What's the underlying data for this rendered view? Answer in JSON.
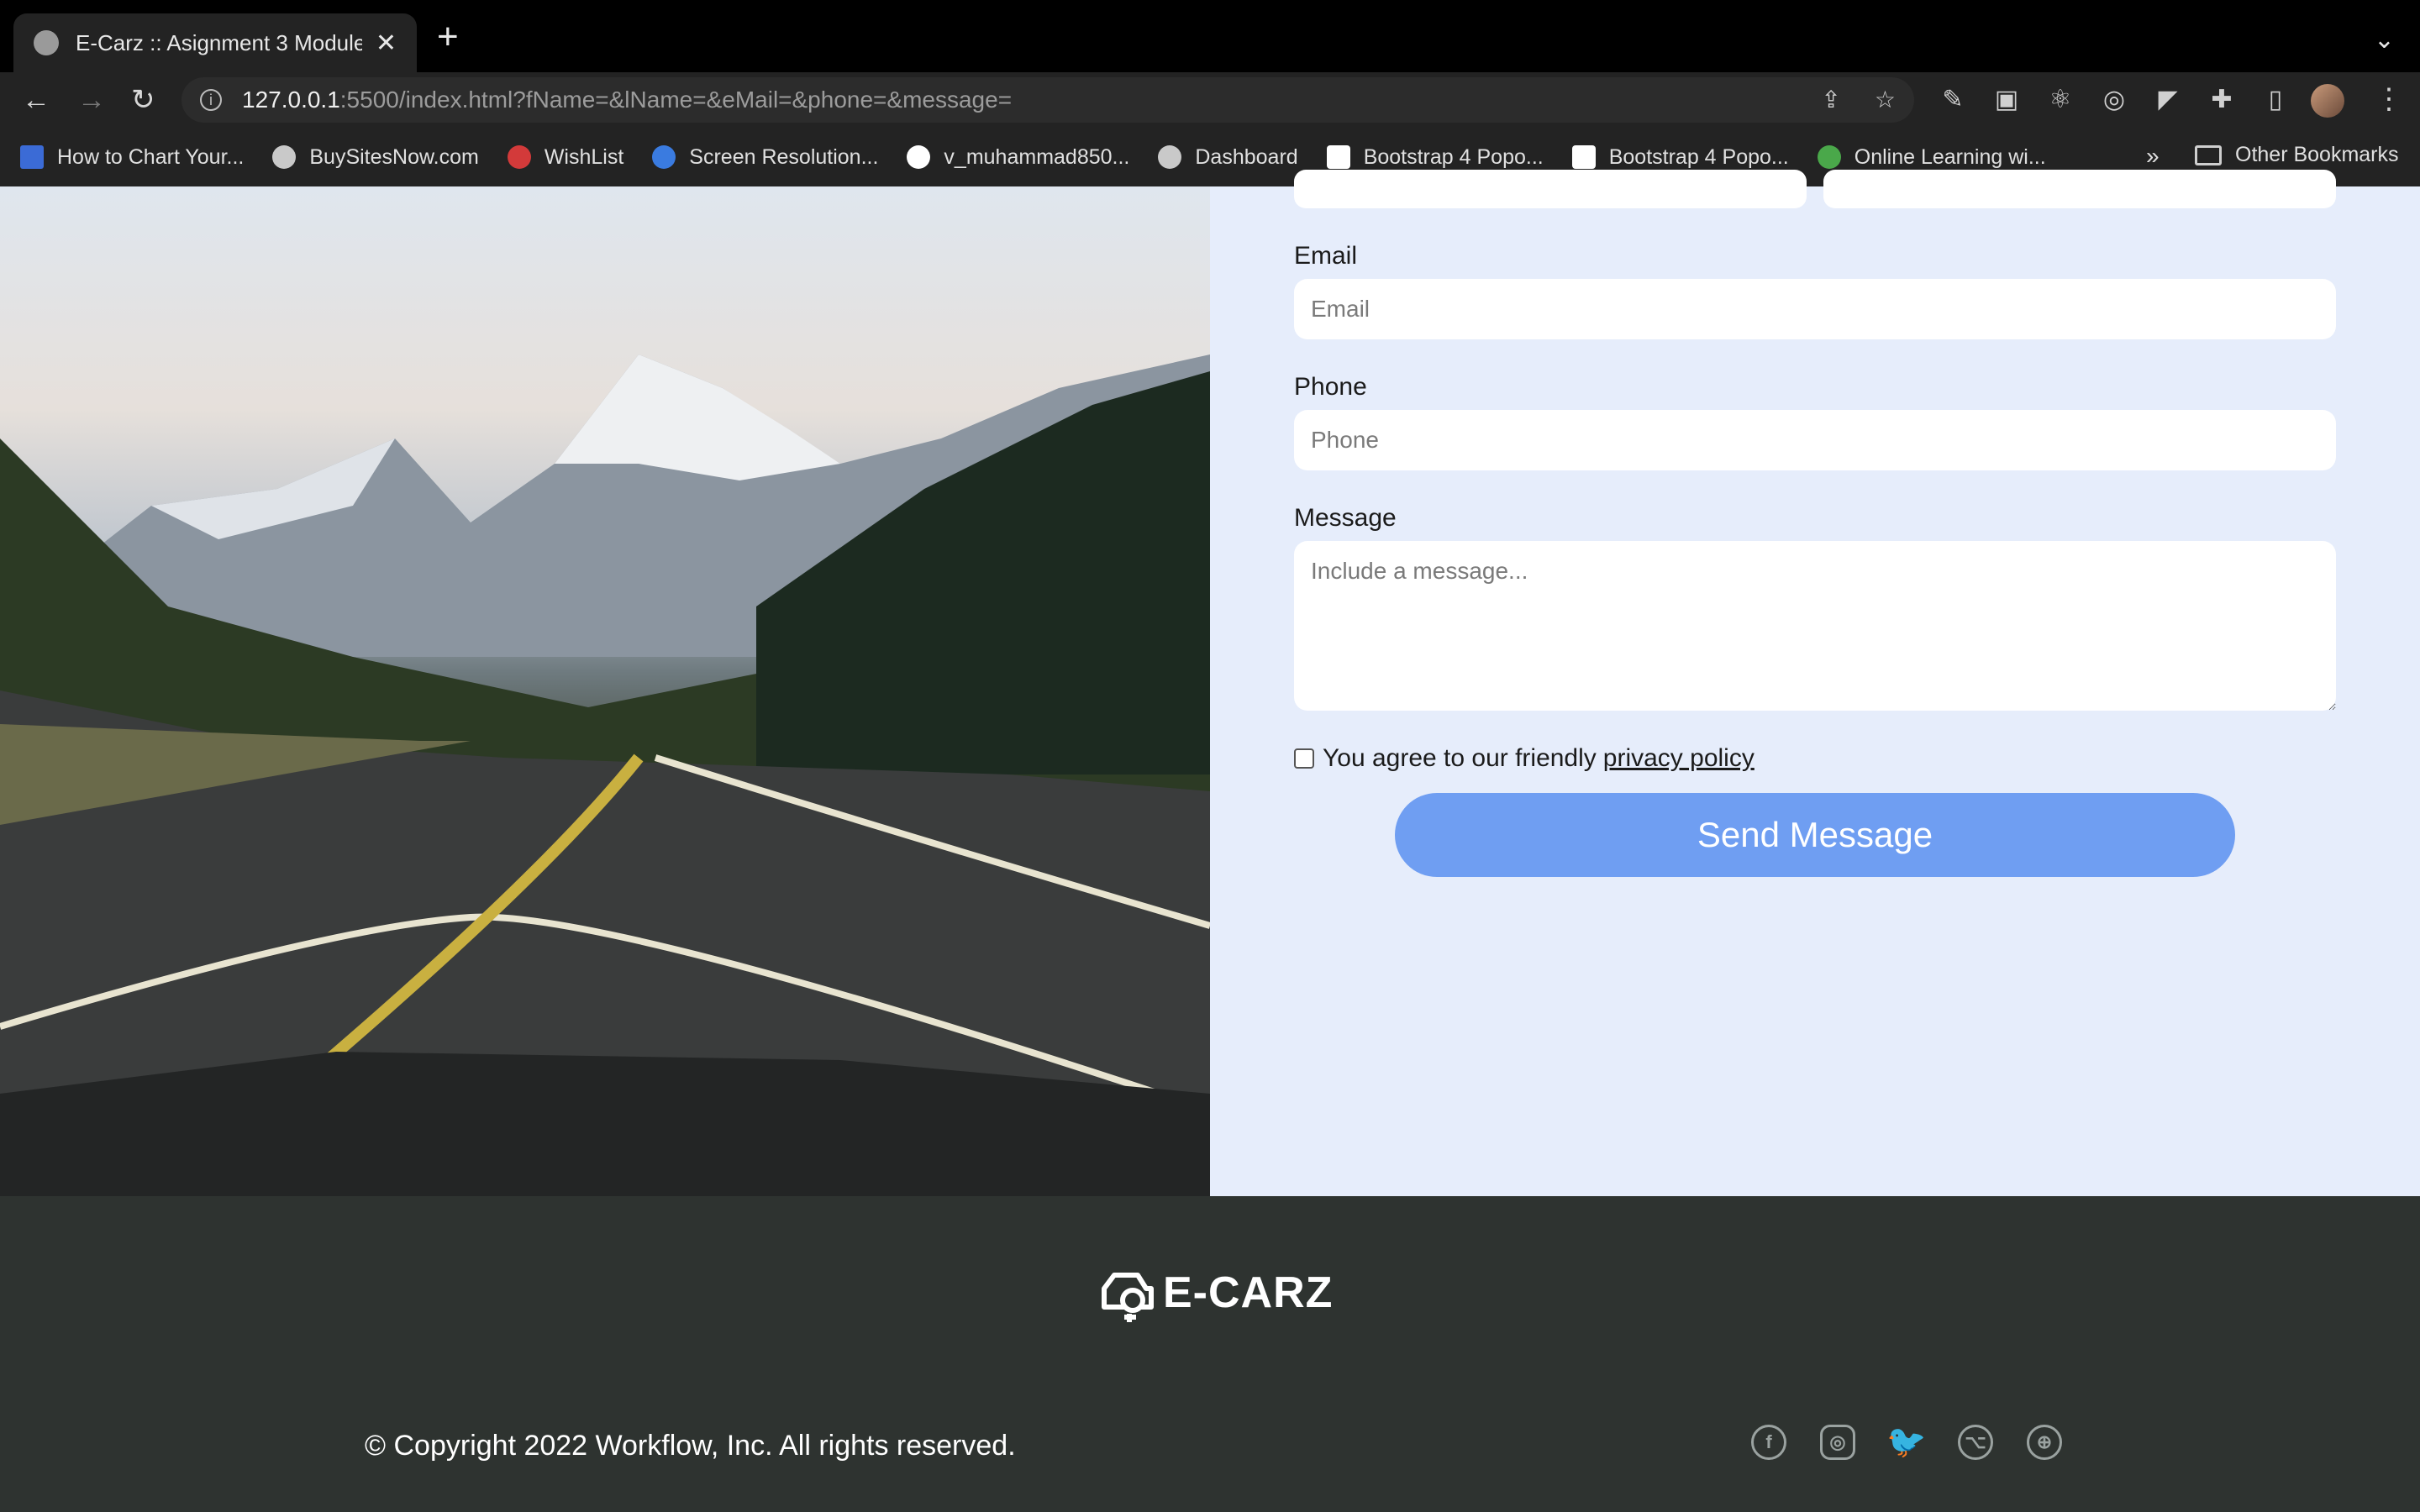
{
  "browser": {
    "tab_title": "E-Carz :: Asignment 3 Module",
    "url_host": "127.0.0.1",
    "url_rest": ":5500/index.html?fName=&lName=&eMail=&phone=&message=",
    "bookmarks": [
      {
        "label": "How to Chart Your...",
        "color": "#3b6bd6"
      },
      {
        "label": "BuySitesNow.com",
        "color": "#c9c9c9"
      },
      {
        "label": "WishList",
        "color": "#d33a3a"
      },
      {
        "label": "Screen Resolution...",
        "color": "#3a7be0"
      },
      {
        "label": "v_muhammad850...",
        "color": "#ffffff"
      },
      {
        "label": "Dashboard",
        "color": "#c9c9c9"
      },
      {
        "label": "Bootstrap 4 Popo...",
        "color": "#ffffff"
      },
      {
        "label": "Bootstrap 4 Popo...",
        "color": "#ffffff"
      },
      {
        "label": "Online Learning wi...",
        "color": "#4aa84a"
      }
    ],
    "more_label": "»",
    "other_bookmarks": "Other Bookmarks"
  },
  "form": {
    "email_label": "Email",
    "email_placeholder": "Email",
    "phone_label": "Phone",
    "phone_placeholder": "Phone",
    "message_label": "Message",
    "message_placeholder": "Include a message...",
    "agree_text": "You agree to our friendly",
    "privacy_link": "privacy policy",
    "send_label": "Send Message"
  },
  "footer": {
    "logo_text": "E-CARZ",
    "copyright": "© Copyright 2022 Workflow, Inc. All rights reserved.",
    "socials": [
      "facebook-icon",
      "instagram-icon",
      "twitter-icon",
      "github-icon",
      "dribbble-icon"
    ]
  },
  "colors": {
    "form_bg": "#e6edfb",
    "button": "#6f9ef2",
    "footer_bg": "#2e3330"
  }
}
